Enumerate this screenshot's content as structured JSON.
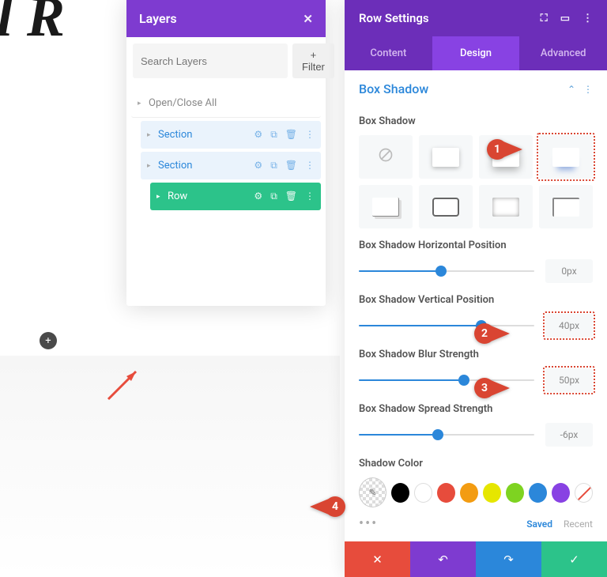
{
  "bg_text": "al R",
  "layers": {
    "title": "Layers",
    "search_placeholder": "Search Layers",
    "filter_label": "+  Filter",
    "items": [
      {
        "label": "Open/Close All",
        "type": "openclose"
      },
      {
        "label": "Section",
        "type": "section"
      },
      {
        "label": "Section",
        "type": "section"
      },
      {
        "label": "Row",
        "type": "row"
      }
    ]
  },
  "settings": {
    "title": "Row Settings",
    "tabs": [
      "Content",
      "Design",
      "Advanced"
    ],
    "active_tab": "Design",
    "section_title": "Box Shadow",
    "presets_label": "Box Shadow",
    "sliders": [
      {
        "label": "Box Shadow Horizontal Position",
        "value": "0px",
        "pos": 47,
        "fill": 47,
        "dotted": false
      },
      {
        "label": "Box Shadow Vertical Position",
        "value": "40px",
        "pos": 70,
        "fill": 70,
        "dotted": true
      },
      {
        "label": "Box Shadow Blur Strength",
        "value": "50px",
        "pos": 60,
        "fill": 60,
        "dotted": true
      },
      {
        "label": "Box Shadow Spread Strength",
        "value": "-6px",
        "pos": 45,
        "fill": 45,
        "dotted": false
      }
    ],
    "shadow_color_label": "Shadow Color",
    "swatches": [
      "#000000",
      "#ffffff",
      "#e74c3c",
      "#f39c12",
      "#e6e600",
      "#7ed321",
      "#2b87da",
      "#8842e3"
    ],
    "saved_label": "Saved",
    "recent_label": "Recent"
  },
  "callouts": {
    "c1": "1",
    "c2": "2",
    "c3": "3",
    "c4": "4"
  }
}
